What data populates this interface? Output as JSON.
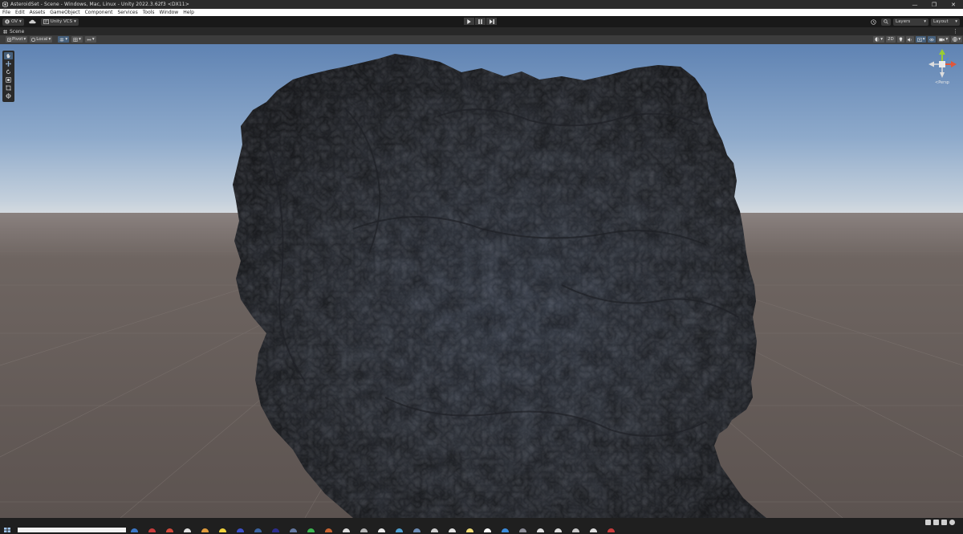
{
  "window": {
    "title": "AsteroidSet - Scene - Windows, Mac, Linux - Unity 2022.3.62f3 <DX11>",
    "minimize": "—",
    "restore": "❐",
    "close": "✕"
  },
  "menu": {
    "items": [
      "File",
      "Edit",
      "Assets",
      "GameObject",
      "Component",
      "Services",
      "Tools",
      "Window",
      "Help"
    ]
  },
  "toolbar": {
    "account_label": "OV",
    "vcs_label": "Unity VCS",
    "layers_label": "Layers",
    "layout_label": "Layout"
  },
  "scene_tab": {
    "label": "Scene"
  },
  "scene_toolbar": {
    "pivot_label": "Pivot",
    "local_label": "Local",
    "mode_2d_label": "2D"
  },
  "gizmo": {
    "label": "<Persp"
  },
  "colors": {
    "sky_top": "#6688b4",
    "horizon": "#c9d4de",
    "ground": "#6d625e",
    "rock": "#3a3e45",
    "accent": "#46607c"
  }
}
